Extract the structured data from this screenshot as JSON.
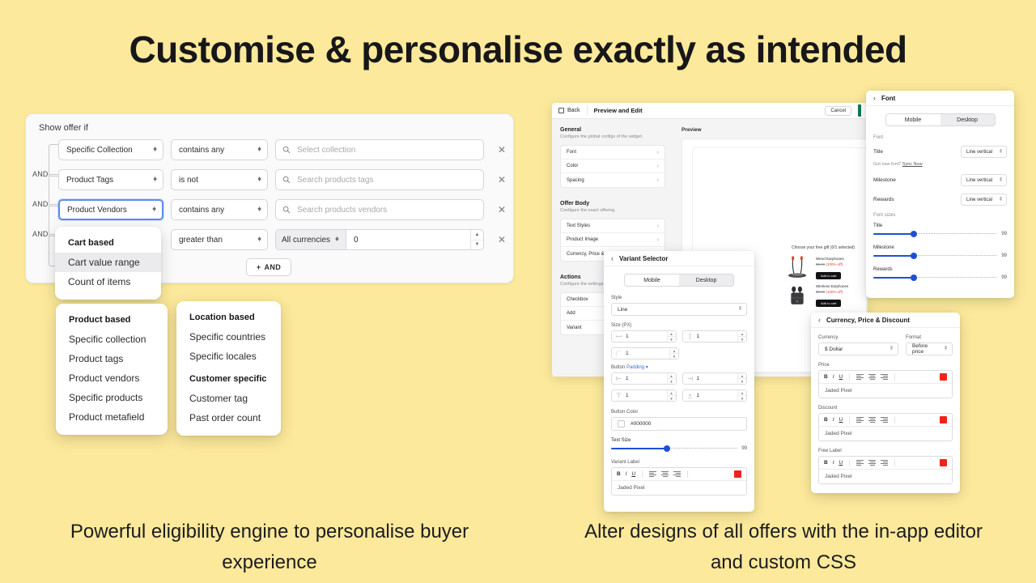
{
  "page": {
    "headline": "Customise & personalise exactly as intended",
    "bg_color": "#FCE99B",
    "caption_left": "Powerful eligibility engine to personalise buyer experience",
    "caption_right": "Alter designs of all offers with the in-app editor and custom CSS"
  },
  "rules": {
    "title": "Show offer if",
    "and_label": "AND",
    "add_button": "AND",
    "add_icon": "plus-icon",
    "close_icon": "x-icon",
    "search_icon": "search-icon",
    "rows": [
      {
        "field": "Specific Collection",
        "operator": "contains any",
        "value_placeholder": "Select collection",
        "focused": false
      },
      {
        "field": "Product Tags",
        "operator": "is not",
        "value_placeholder": "Search products tags",
        "focused": false
      },
      {
        "field": "Product Vendors",
        "operator": "contains any",
        "value_placeholder": "Search products vendors",
        "focused": true
      }
    ],
    "value_row": {
      "operator": "greater than",
      "currency": "All currencies",
      "amount": "0"
    }
  },
  "menus": {
    "cart": {
      "header": "Cart based",
      "items": [
        "Cart value range",
        "Count of items"
      ],
      "highlighted": "Cart value range"
    },
    "product": {
      "header": "Product based",
      "items": [
        "Specific collection",
        "Product tags",
        "Product vendors",
        "Specific products",
        "Product metafield"
      ]
    },
    "location": {
      "header": "Location based",
      "items": [
        "Specific countries",
        "Specific locales"
      ],
      "header2": "Customer specific",
      "items2": [
        "Customer tag",
        "Past order count"
      ]
    }
  },
  "editor": {
    "back_label": "Back",
    "title": "Preview and Edit",
    "cancel_label": "Cancel",
    "sidebar": [
      {
        "group": "General",
        "subtitle": "Configure the global configs of the widget.",
        "items": [
          "Font",
          "Color",
          "Spacing"
        ]
      },
      {
        "group": "Offer Body",
        "subtitle": "Configure the exact offering",
        "items": [
          "Text Styles",
          "Product Image",
          "Currency, Price & Discount"
        ]
      },
      {
        "group": "Actions",
        "subtitle": "Configure the settings",
        "items": [
          "Checkbox",
          "Add",
          "Variant"
        ]
      }
    ],
    "preview_label": "Preview",
    "gift_title": "Choose your free gift (0/1 selected)",
    "gifts": [
      {
        "name": "Wired Earphones",
        "old_price": "$0.99",
        "discount": "(100% off)",
        "cta": "Add to cart"
      },
      {
        "name": "Wireless Earphones",
        "old_price": "$0.99",
        "discount": "(100% off)",
        "cta": "Add to cart"
      }
    ]
  },
  "variant_panel": {
    "title": "Variant Selector",
    "back_icon": "chevron-left-icon",
    "segments": [
      "Mobile",
      "Desktop"
    ],
    "segment_active": "Mobile",
    "style_label": "Style",
    "style_value": "Line",
    "size_label": "Size (PX)",
    "size_values": [
      "1",
      "1",
      "1"
    ],
    "button_label": "Button",
    "button_sub": "Padding",
    "padding_values": [
      "1",
      "1",
      "1",
      "1"
    ],
    "button_color_label": "Button Color",
    "button_color_value": "#000000",
    "text_size_label": "Text Size",
    "text_size_value": "99",
    "variant_label_label": "Variant Label",
    "variant_label_value": "Jaded Pixel",
    "rte_bold": "B",
    "rte_italic": "I",
    "rte_underline": "U",
    "rte_color": "#F0231A"
  },
  "font_panel": {
    "title": "Font",
    "back_icon": "chevron-left-icon",
    "segments": [
      "Mobile",
      "Desktop"
    ],
    "segment_active": "Mobile",
    "font_section": "Font",
    "font_rows": [
      {
        "label": "Title",
        "value": "Line vertical"
      },
      {
        "label": "Milestone",
        "value": "Line vertical"
      },
      {
        "label": "Rewards",
        "value": "Line vertical"
      }
    ],
    "sync_text": "Got new font?",
    "sync_link": "Sync Now",
    "sizes_section": "Font sizes",
    "size_rows": [
      {
        "label": "Title",
        "value": "99"
      },
      {
        "label": "Milestone",
        "value": "99"
      },
      {
        "label": "Rewards",
        "value": "99"
      }
    ]
  },
  "currency_panel": {
    "title": "Currency, Price & Discount",
    "back_icon": "chevron-left-icon",
    "currency_label": "Currency",
    "currency_value": "$ Dollar",
    "format_label": "Format",
    "format_value": "Before price",
    "fields": [
      {
        "label": "Price",
        "value": "Jaded Pixel"
      },
      {
        "label": "Discount",
        "value": "Jaded Pixel"
      },
      {
        "label": "Free Label",
        "value": "Jaded Pixel"
      }
    ],
    "rte_bold": "B",
    "rte_italic": "I",
    "rte_underline": "U",
    "rte_color": "#F0231A"
  }
}
